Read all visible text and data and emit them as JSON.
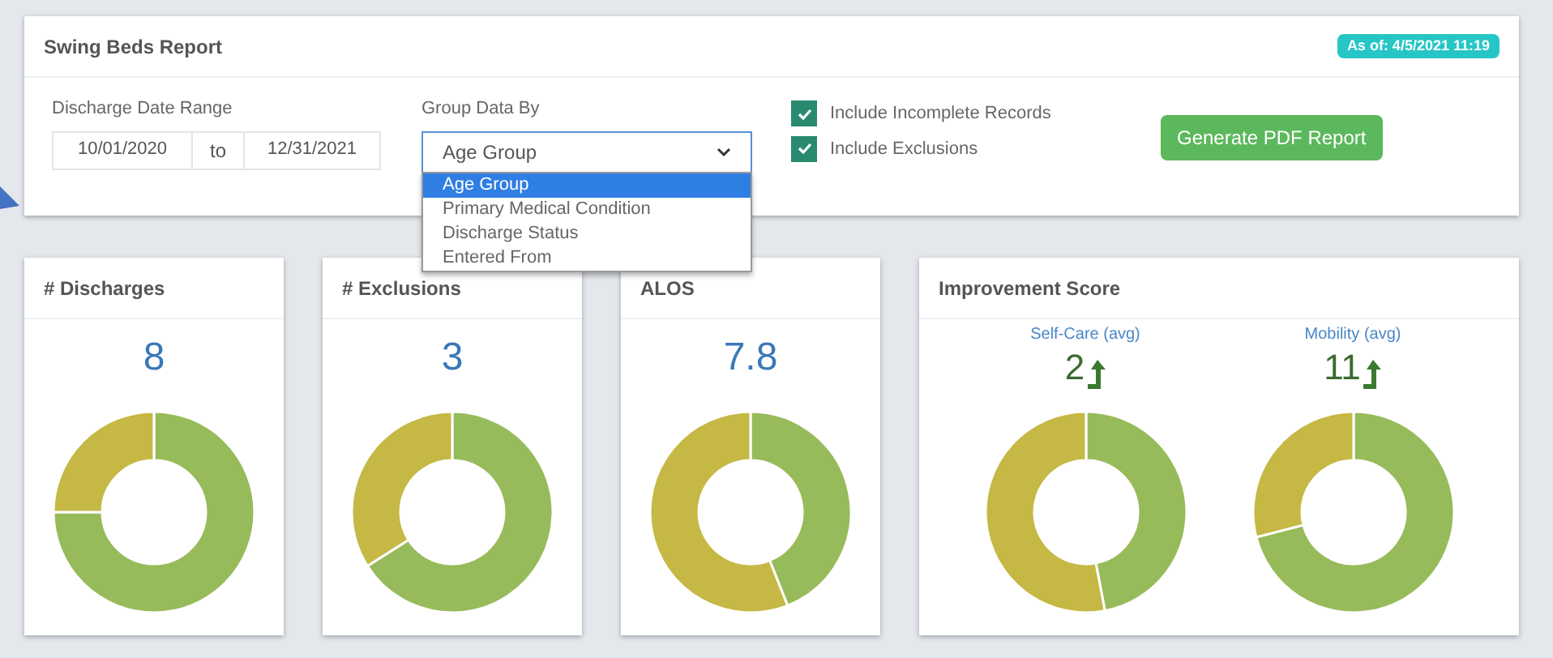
{
  "report": {
    "title": "Swing Beds Report",
    "as_of": "As of: 4/5/2021 11:19"
  },
  "filters": {
    "date_range": {
      "label": "Discharge Date Range",
      "from": "10/01/2020",
      "separator": "to",
      "to": "12/31/2021"
    },
    "group_by": {
      "label": "Group Data By",
      "value": "Age Group",
      "expanded": true,
      "options": [
        {
          "label": "Age Group",
          "selected": true
        },
        {
          "label": "Primary Medical Condition",
          "selected": false
        },
        {
          "label": "Discharge Status",
          "selected": false
        },
        {
          "label": "Entered From",
          "selected": false
        }
      ]
    },
    "checkboxes": [
      {
        "label": "Include Incomplete Records",
        "checked": true
      },
      {
        "label": "Include Exclusions",
        "checked": true
      }
    ],
    "button": "Generate PDF Report"
  },
  "cards": [
    {
      "title": "# Discharges",
      "value": "8"
    },
    {
      "title": "# Exclusions",
      "value": "3"
    },
    {
      "title": "ALOS",
      "value": "7.8"
    }
  ],
  "improvement": {
    "title": "Improvement Score",
    "metrics": [
      {
        "label": "Self-Care (avg)",
        "value": "2"
      },
      {
        "label": "Mobility (avg)",
        "value": "11"
      }
    ]
  }
}
